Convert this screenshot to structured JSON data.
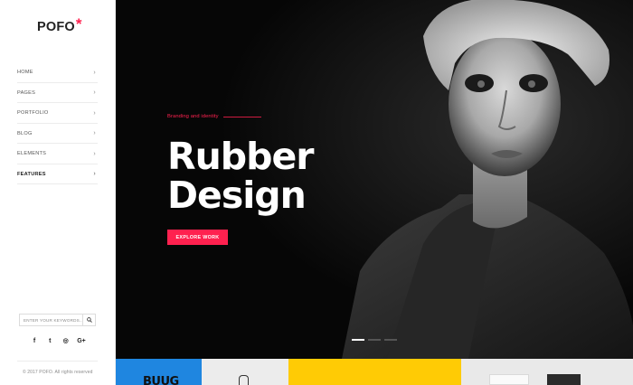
{
  "brand": {
    "name": "POFO",
    "mark": "*"
  },
  "nav": {
    "items": [
      {
        "label": "HOME"
      },
      {
        "label": "PAGES"
      },
      {
        "label": "PORTFOLIO"
      },
      {
        "label": "BLOG"
      },
      {
        "label": "ELEMENTS"
      },
      {
        "label": "FEATURES",
        "active": true
      }
    ],
    "chevron": "›"
  },
  "search": {
    "placeholder": "ENTER YOUR KEYWORDS..."
  },
  "social": {
    "facebook": "f",
    "twitter": "t",
    "dribbble": "◎",
    "google_plus": "G+"
  },
  "copyright": "© 2017 POFO. All rights reserved",
  "hero": {
    "eyebrow": "Branding and identity",
    "headline_line1": "Rubber",
    "headline_line2": "Design",
    "cta_label": "EXPLORE WORK",
    "slide_dots": 3,
    "active_dot": 0
  },
  "bottom_strip": {
    "tile1_text": "BUUG"
  },
  "colors": {
    "accent": "#ff214f",
    "hero_bg": "#060606",
    "tile_blue": "#1f86e0",
    "tile_yellow": "#ffcb05"
  }
}
